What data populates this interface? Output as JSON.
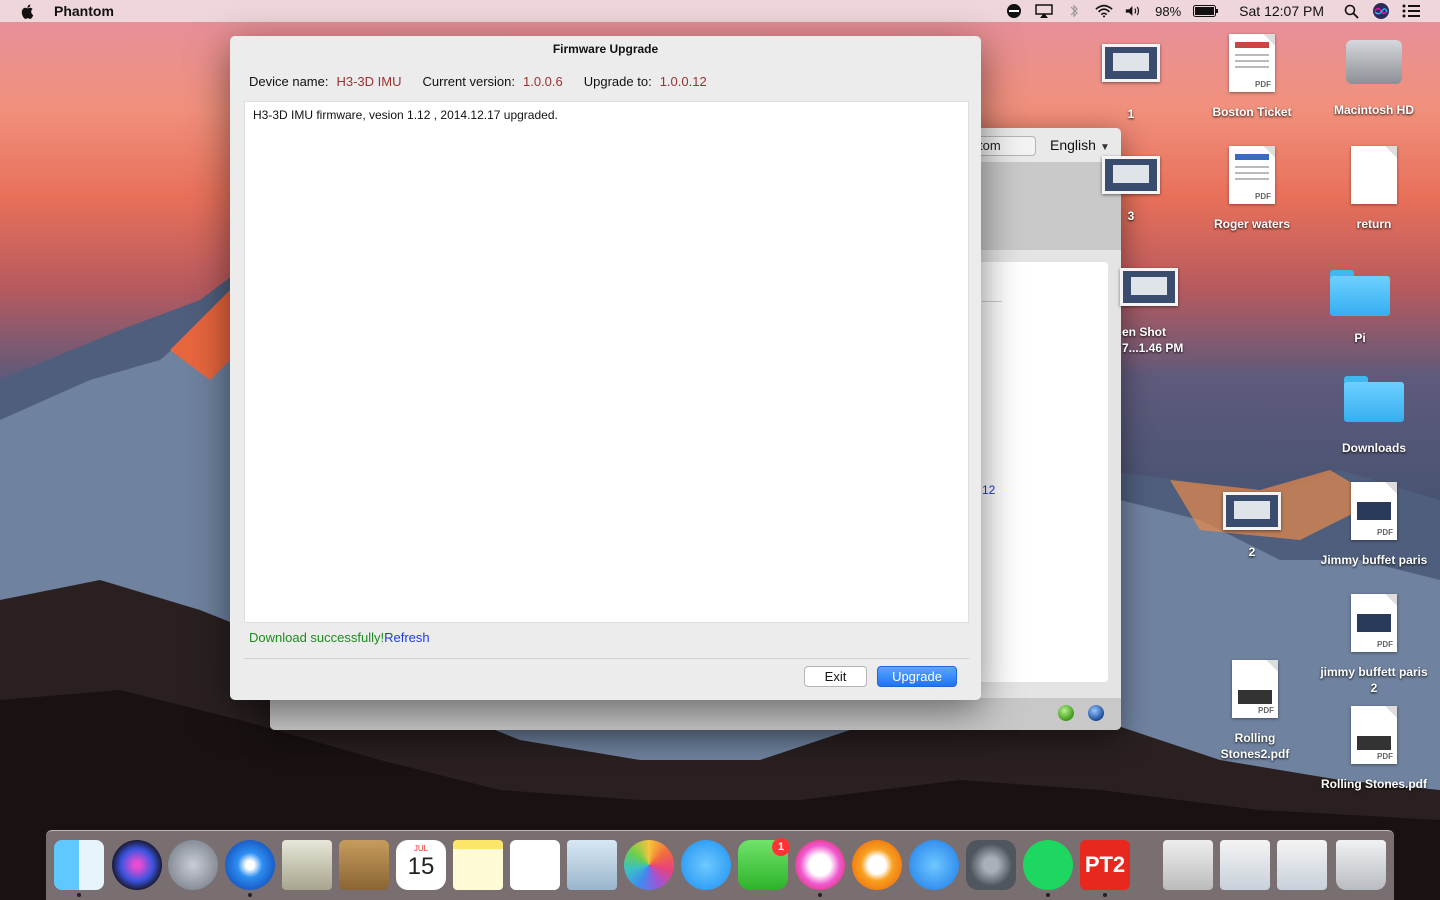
{
  "menubar": {
    "app_name": "Phantom",
    "battery": "98%",
    "clock": "Sat 12:07 PM"
  },
  "background_window": {
    "custom_label": "tom",
    "language": "English",
    "partial_text": "12"
  },
  "dialog": {
    "title": "Firmware Upgrade",
    "device_label": "Device name:",
    "device_value": "H3-3D IMU",
    "current_label": "Current version:",
    "current_value": "1.0.0.6",
    "upgrade_label": "Upgrade to:",
    "upgrade_value": "1.0.0.12",
    "log": "H3-3D IMU firmware, vesion 1.12 , 2014.12.17 upgraded.",
    "status": "Download successfully!",
    "refresh": "Refresh",
    "exit_label": "Exit",
    "upgrade_button": "Upgrade"
  },
  "desktop": {
    "icons": [
      {
        "label": "1"
      },
      {
        "label": "Boston Ticket"
      },
      {
        "label": "Macintosh HD"
      },
      {
        "label": "3"
      },
      {
        "label": "Roger waters"
      },
      {
        "label": "return"
      },
      {
        "label": "en Shot\n7...1.46 PM"
      },
      {
        "label": "Pi"
      },
      {
        "label": "Downloads"
      },
      {
        "label": "2"
      },
      {
        "label": "Jimmy buffet paris"
      },
      {
        "label": "jimmy buffett paris\n2"
      },
      {
        "label": "Rolling\nStones2.pdf"
      },
      {
        "label": "Rolling Stones.pdf"
      }
    ]
  },
  "dock": {
    "calendar_month": "JUL",
    "calendar_day": "15",
    "facetime_badge": "1",
    "pt2_label": "PT2"
  }
}
